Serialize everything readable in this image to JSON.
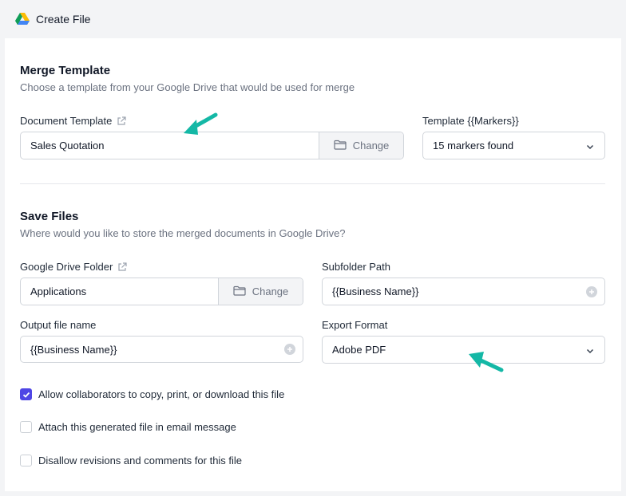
{
  "header": {
    "title": "Create File",
    "logo_icon": "google-drive-icon"
  },
  "merge_template": {
    "title": "Merge Template",
    "description": "Choose a template from your Google Drive that would be used for merge",
    "document_template": {
      "label": "Document Template",
      "value": "Sales Quotation",
      "change_label": "Change"
    },
    "markers": {
      "label": "Template {{Markers}}",
      "value": "15 markers found"
    }
  },
  "save_files": {
    "title": "Save Files",
    "description": "Where would you like to store the merged documents in Google Drive?",
    "folder": {
      "label": "Google Drive Folder",
      "value": "Applications",
      "change_label": "Change"
    },
    "subfolder": {
      "label": "Subfolder Path",
      "value": "{{Business Name}}"
    },
    "output_name": {
      "label": "Output file name",
      "value": "{{Business Name}}"
    },
    "export_format": {
      "label": "Export Format",
      "value": "Adobe PDF"
    }
  },
  "options": [
    {
      "label": "Allow collaborators to copy, print, or download this file",
      "checked": true
    },
    {
      "label": "Attach this generated file in email message",
      "checked": false
    },
    {
      "label": "Disallow revisions and comments for this file",
      "checked": false
    }
  ],
  "colors": {
    "accent": "#4f46e5",
    "arrow": "#14b8a6"
  }
}
